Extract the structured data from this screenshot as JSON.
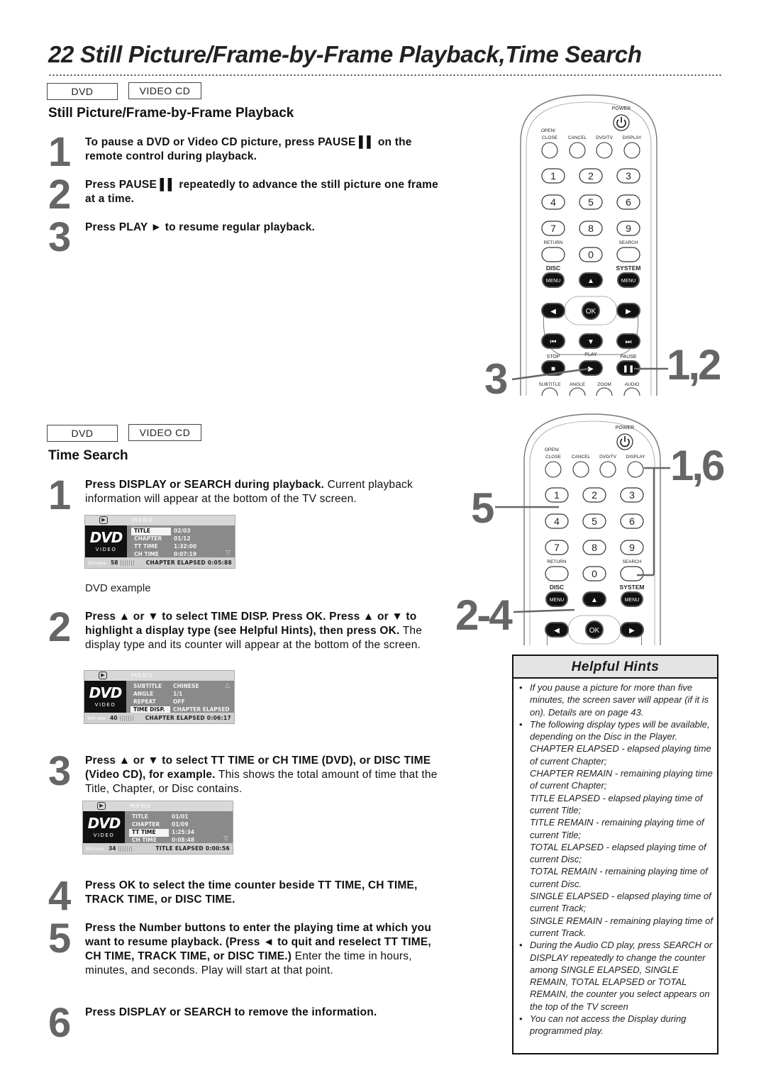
{
  "page": {
    "title": "22  Still Picture/Frame-by-Frame Playback,Time Search"
  },
  "section1": {
    "tags": [
      "DVD",
      "VIDEO CD"
    ],
    "heading": "Still Picture/Frame-by-Frame Playback",
    "steps": [
      {
        "num": "1",
        "bold": "To pause a DVD or Video CD picture, press PAUSE ▌▌ on the remote control during playback.",
        "normal": ""
      },
      {
        "num": "2",
        "bold": "Press PAUSE ▌▌ repeatedly to advance the still picture one frame at a time.",
        "normal": ""
      },
      {
        "num": "3",
        "bold": "Press PLAY ►  to resume regular playback.",
        "normal": ""
      }
    ]
  },
  "section2": {
    "tags": [
      "DVD",
      "VIDEO CD"
    ],
    "heading": "Time Search",
    "steps": [
      {
        "num": "1",
        "bold": "Press DISPLAY or SEARCH during playback.",
        "normal": " Current playback information will appear at the bottom of the TV screen."
      },
      {
        "num": "2",
        "bold": "Press ▲ or ▼ to select TIME DISP. Press OK. Press ▲ or ▼ to highlight a display type (see Helpful Hints), then press OK.",
        "normal": " The display type and its counter will appear at the bottom of the screen."
      },
      {
        "num": "3",
        "bold": "Press ▲ or ▼ to select TT TIME or CH TIME (DVD), or DISC TIME (Video CD), for example.",
        "normal": " This shows the total amount of time that the Title, Chapter, or Disc contains."
      },
      {
        "num": "4",
        "bold": "Press OK to select the time counter beside TT TIME, CH TIME, TRACK TIME, or DISC TIME.",
        "normal": ""
      },
      {
        "num": "5",
        "bold": "Press the Number buttons to enter the playing time at which you want to resume playback. (Press ◄ to quit and reselect TT TIME, CH TIME, TRACK TIME, or DISC TIME.)",
        "normal": " Enter the time in hours, minutes, and seconds. Play will start at that point."
      },
      {
        "num": "6",
        "bold": "Press DISPLAY or SEARCH to remove the information.",
        "normal": ""
      }
    ],
    "caption": "DVD example"
  },
  "osd": {
    "menu_label": "MENU",
    "logo_big": "DVD",
    "logo_small": "VIDEO",
    "screens": [
      {
        "rows": [
          {
            "k": "TITLE",
            "v": "02/03",
            "hl": true
          },
          {
            "k": "CHAPTER",
            "v": "01/12",
            "hl": false
          },
          {
            "k": "TT  TIME",
            "v": "1:32:00",
            "hl": false
          },
          {
            "k": "CH  TIME",
            "v": "0:07:19",
            "hl": false
          }
        ],
        "arrow": "▽",
        "foot_count": "58",
        "foot_status": "CHAPTER  ELAPSED  0:05:88"
      },
      {
        "rows": [
          {
            "k": "SUBTITLE",
            "v": "CHINESE",
            "hl": false
          },
          {
            "k": "ANGLE",
            "v": "1/1",
            "hl": false
          },
          {
            "k": "REPEAT",
            "v": "OFF",
            "hl": false
          },
          {
            "k": "TIME  DISP.",
            "v": "CHAPTER  ELAPSED",
            "hl": true
          }
        ],
        "arrow": "△",
        "foot_count": "40",
        "foot_status": "CHAPTER  ELAPSED  0:06:17"
      },
      {
        "rows": [
          {
            "k": "TITLE",
            "v": "01/01",
            "hl": false
          },
          {
            "k": "CHAPTER",
            "v": "01/09",
            "hl": false
          },
          {
            "k": "TT  TIME",
            "v": "1:25:34",
            "hl": true
          },
          {
            "k": "CH  TIME",
            "v": "0:08:48",
            "hl": false
          }
        ],
        "arrow": "▽",
        "foot_count": "34",
        "foot_status": "TITLE  ELAPSED  0:00:56"
      }
    ]
  },
  "remote": {
    "power": "POWER",
    "top_labels": [
      "OPEN/\nCLOSE",
      "CANCEL",
      "DVD/TV",
      "DISPLAY"
    ],
    "digits": [
      "1",
      "2",
      "3",
      "4",
      "5",
      "6",
      "7",
      "8",
      "9",
      "0"
    ],
    "return": "RETURN",
    "search": "SEARCH",
    "disc": "DISC",
    "system": "SYSTEM",
    "menu": "MENU",
    "ok": "OK",
    "stop": "STOP",
    "play": "PLAY",
    "pause": "PAUSE",
    "bottom_labels": [
      "SUBTITLE",
      "ANGLE",
      "ZOOM",
      "AUDIO"
    ]
  },
  "callouts": {
    "upper_left": "3",
    "upper_right": "1,2",
    "lower_right": "1,6",
    "lower_left_mid": "5",
    "lower_left_bottom": "2-4"
  },
  "hints": {
    "title": "Helpful Hints",
    "bullet": "•",
    "items": [
      {
        "text": "If you pause a picture for more than five minutes, the screen saver will appear (if it is on). Details are on page 43.",
        "subs": []
      },
      {
        "text": "The following display types will be available, depending on the Disc in the Player.",
        "subs": [
          "CHAPTER ELAPSED - elapsed playing time of current Chapter;",
          "CHAPTER REMAIN - remaining playing time of current Chapter;",
          "TITLE ELAPSED - elapsed playing time of current Title;",
          "TITLE REMAIN - remaining playing time of current Title;",
          "TOTAL ELAPSED - elapsed playing time of current Disc;",
          "TOTAL REMAIN - remaining playing time of current Disc.",
          "SINGLE ELAPSED - elapsed playing time of current Track;",
          "SINGLE REMAIN - remaining playing time of current Track."
        ]
      },
      {
        "text": "During the Audio CD play, press SEARCH or DISPLAY repeatedly to change the counter among SINGLE ELAPSED, SINGLE REMAIN, TOTAL ELAPSED or TOTAL REMAIN, the counter you select appears on the top of the TV screen",
        "subs": []
      },
      {
        "text": "You can not access the Display during programmed play.",
        "subs": []
      }
    ]
  }
}
